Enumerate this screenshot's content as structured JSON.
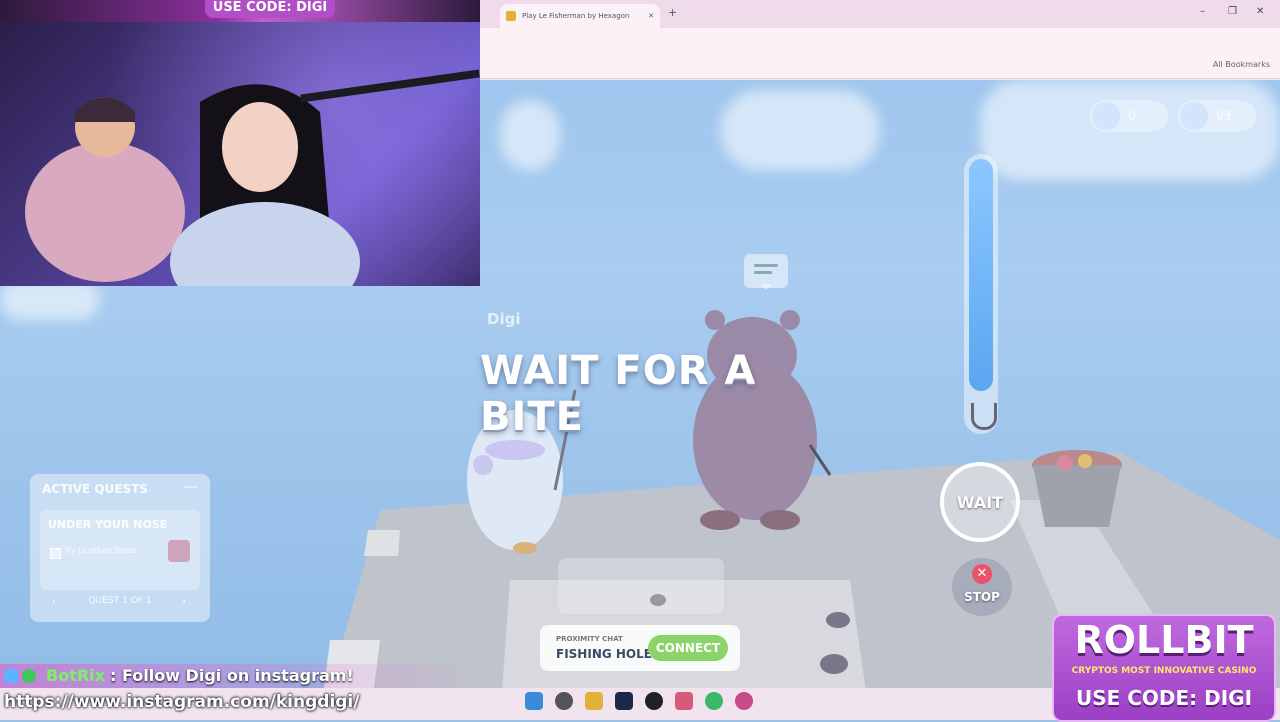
{
  "browser": {
    "tab_title": "Play Le Fisherman by Hexagon",
    "bookmarks_label": "All Bookmarks",
    "window_controls": [
      "–",
      "❐",
      "✕"
    ]
  },
  "stream": {
    "promo_top": "USE CODE: DIGI",
    "chat_user": "BotRix",
    "chat_message": ": Follow Digi on instagram!",
    "chat_url": "https://www.instagram.com/kingdigi/"
  },
  "game": {
    "player_name": "Digi",
    "status_text": "WAIT FOR A BITE",
    "hud": {
      "coins": "0",
      "gems": "93"
    },
    "bite_meter_fill": 0.86,
    "wait_button": "WAIT",
    "stop_button": "STOP",
    "quests": {
      "title": "ACTIVE QUESTS",
      "quest_name": "UNDER YOUR NOSE",
      "quest_task": "Try to refuel Boats",
      "pager": "QUEST 1 OF 1"
    },
    "proximity": {
      "label": "PROXIMITY CHAT",
      "location": "FISHING HOLE",
      "connect_button": "CONNECT"
    }
  },
  "ad": {
    "brand": "ROLLBIT",
    "tagline": "CRYPTOS MOST INNOVATIVE CASINO",
    "code": "USE CODE: DIGI"
  },
  "colors": {
    "water": "#9fc6ee",
    "accent_purple": "#b04fc6",
    "connect_green": "#8dd36c",
    "stop_red": "#e8546a"
  }
}
